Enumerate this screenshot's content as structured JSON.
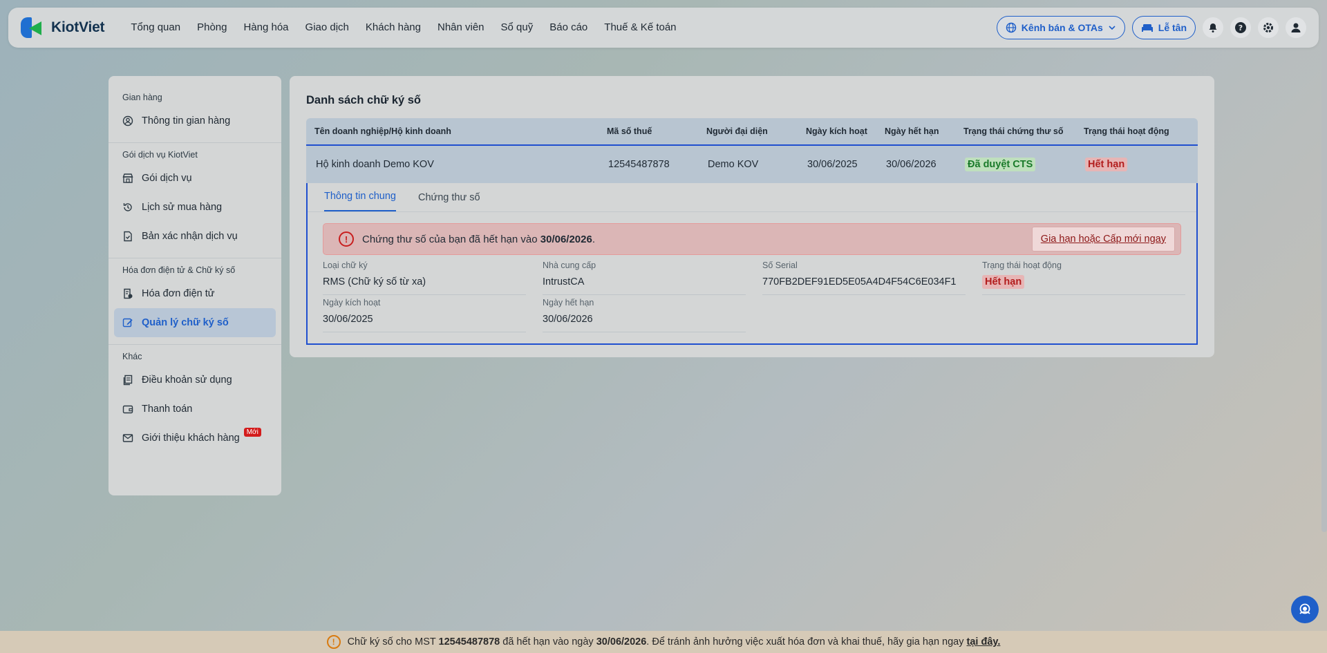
{
  "nav": {
    "logo": "KiotViet",
    "items": [
      "Tổng quan",
      "Phòng",
      "Hàng hóa",
      "Giao dịch",
      "Khách hàng",
      "Nhân viên",
      "Sổ quỹ",
      "Báo cáo",
      "Thuế & Kế toán"
    ],
    "channels_label": "Kênh bán & OTAs",
    "reception_label": "Lễ tân"
  },
  "sidebar": {
    "groups": [
      {
        "title": "Gian hàng",
        "items": [
          {
            "label": "Thông tin gian hàng"
          }
        ]
      },
      {
        "title": "Gói dịch vụ KiotViet",
        "items": [
          {
            "label": "Gói dịch vụ"
          },
          {
            "label": "Lịch sử mua hàng"
          },
          {
            "label": "Bản xác nhận dịch vụ"
          }
        ]
      },
      {
        "title": "Hóa đơn điện tử & Chữ ký số",
        "items": [
          {
            "label": "Hóa đơn điện tử"
          },
          {
            "label": "Quản lý chữ ký số"
          }
        ]
      },
      {
        "title": "Khác",
        "items": [
          {
            "label": "Điều khoản sử dụng"
          },
          {
            "label": "Thanh toán"
          },
          {
            "label": "Giới thiệu khách hàng",
            "badge": "Mới"
          }
        ]
      }
    ]
  },
  "main": {
    "title": "Danh sách chữ ký số",
    "columns": [
      "Tên doanh nghiệp/Hộ kinh doanh",
      "Mã số thuế",
      "Người đại diện",
      "Ngày kích hoạt",
      "Ngày hết hạn",
      "Trạng thái chứng thư số",
      "Trạng thái hoạt động"
    ],
    "row": {
      "name": "Hộ kinh doanh Demo KOV",
      "mst": "12545487878",
      "rep": "Demo KOV",
      "activated": "30/06/2025",
      "expired": "30/06/2026",
      "cts_status": "Đã duyệt CTS",
      "status": "Hết hạn"
    },
    "tabs": [
      "Thông tin chung",
      "Chứng thư số"
    ],
    "alert": {
      "text_prefix": "Chứng thư số của bạn đã hết hạn vào ",
      "date": "30/06/2026",
      "text_suffix": ".",
      "button": "Gia hạn hoặc Cấp mới ngay"
    },
    "fields": [
      {
        "label": "Loại chữ ký",
        "value": "RMS (Chữ ký số từ xa)"
      },
      {
        "label": "Nhà cung cấp",
        "value": "IntrustCA"
      },
      {
        "label": "Số Serial",
        "value": "770FB2DEF91ED5E05A4D4F54C6E034F1"
      },
      {
        "label": "Trạng thái hoạt động",
        "value": "Hết hạn"
      },
      {
        "label": "Ngày kích hoạt",
        "value": "30/06/2025"
      },
      {
        "label": "Ngày hết hạn",
        "value": "30/06/2026"
      }
    ]
  },
  "banner": {
    "p1": "Chữ ký số cho MST ",
    "mst": "12545487878",
    "p2": " đã hết hạn vào ngày ",
    "date": "30/06/2026",
    "p3": ". Để tránh ảnh hưởng việc xuất hóa đơn và khai thuế, hãy gia hạn ngay ",
    "link": "tại đây."
  },
  "colors": {
    "accent": "#1f5fc9",
    "danger": "#c81e1e",
    "success": "#1a7a2a"
  }
}
